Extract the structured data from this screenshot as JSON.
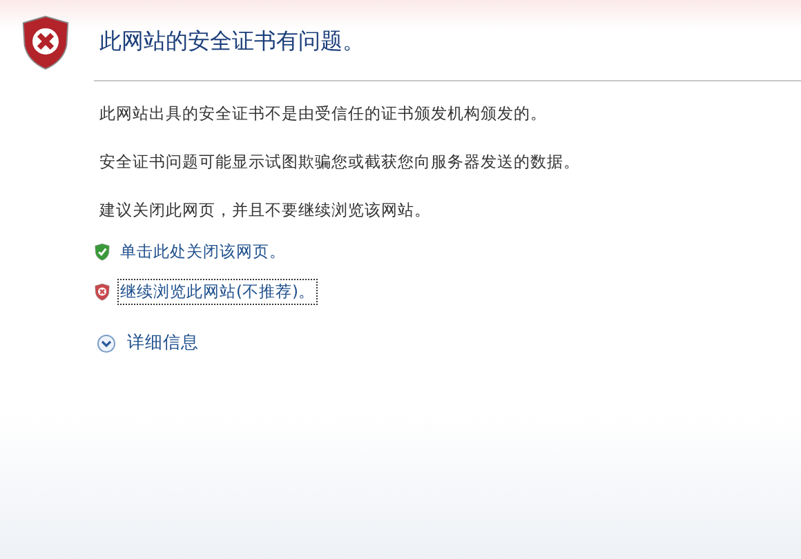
{
  "title": "此网站的安全证书有问题。",
  "paragraphs": [
    "此网站出具的安全证书不是由受信任的证书颁发机构颁发的。",
    "安全证书问题可能显示试图欺骗您或截获您向服务器发送的数据。",
    "建议关闭此网页，并且不要继续浏览该网站。"
  ],
  "links": [
    {
      "kind": "safe",
      "label": "单击此处关闭该网页。",
      "focused": false
    },
    {
      "kind": "unsafe",
      "label": "继续浏览此网站(不推荐)。",
      "focused": true
    }
  ],
  "details": {
    "label": "详细信息",
    "expanded": false
  }
}
